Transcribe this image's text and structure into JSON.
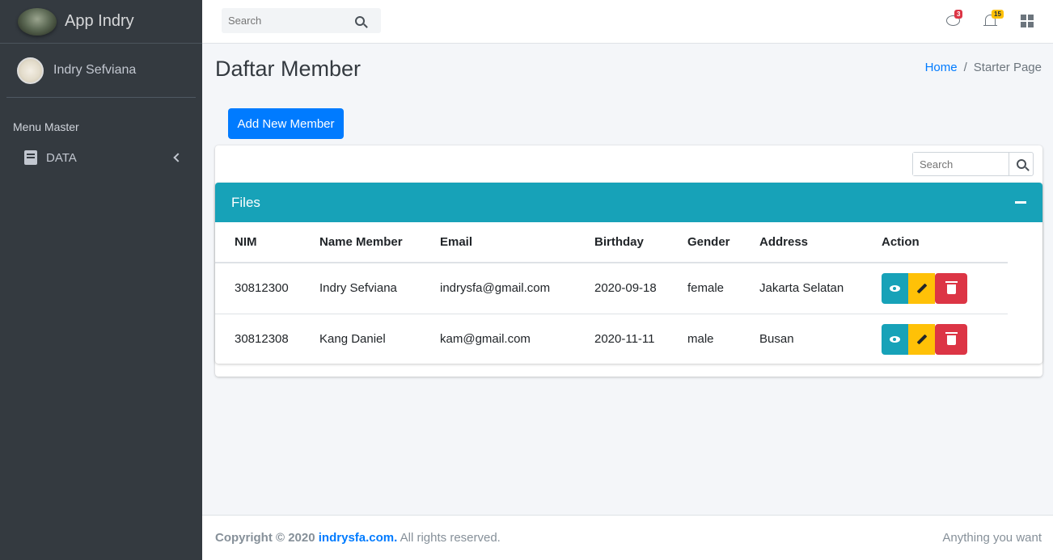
{
  "sidebar": {
    "brand": "App Indry",
    "user_name": "Indry Sefviana",
    "menu_header": "Menu Master",
    "items": [
      {
        "label": "DATA",
        "icon": "book-icon"
      }
    ]
  },
  "topbar": {
    "search_placeholder": "Search",
    "messages_badge": "3",
    "notifications_badge": "15"
  },
  "page": {
    "title": "Daftar Member",
    "breadcrumb": [
      "Home",
      "Starter Page"
    ],
    "add_button": "Add New Member"
  },
  "card": {
    "search_placeholder": "Search",
    "title": "Files",
    "columns": [
      "NIM",
      "Name Member",
      "Email",
      "Birthday",
      "Gender",
      "Address",
      "Action"
    ],
    "rows": [
      {
        "nim": "30812300",
        "name": "Indry Sefviana",
        "email": "indrysfa@gmail.com",
        "birthday": "2020-09-18",
        "gender": "female",
        "address": "Jakarta Selatan"
      },
      {
        "nim": "30812308",
        "name": "Kang Daniel",
        "email": "kam@gmail.com",
        "birthday": "2020-11-11",
        "gender": "male",
        "address": "Busan"
      }
    ]
  },
  "footer": {
    "copyright_prefix": "Copyright © 2020",
    "site": "indrysfa.com.",
    "rights": "All rights reserved.",
    "right_text": "Anything you want"
  },
  "colors": {
    "sidebar_bg": "#343a40",
    "primary": "#007bff",
    "info": "#17a2b8",
    "warning": "#ffc107",
    "danger": "#dc3545"
  }
}
